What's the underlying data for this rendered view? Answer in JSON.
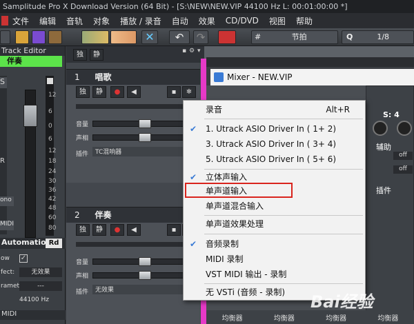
{
  "app": {
    "title": "Samplitude Pro X Download Version (64 Bit) - [S:\\NEW\\NEW.VIP  44100 Hz L: 00:01:00:00 *]"
  },
  "menu": [
    "文件",
    "编辑",
    "音轨",
    "对象",
    "播放 / 录音",
    "自动",
    "效果",
    "CD/DVD",
    "视图",
    "帮助"
  ],
  "toolbar": {
    "beat_label": "节拍",
    "q_label": "Q",
    "q_value": "1/8",
    "mixer_icon": "mixer-x-icon"
  },
  "left_panel": {
    "header": "Track Editor",
    "track_name": "伴奏",
    "scale": [
      "12",
      "6",
      "0",
      "6",
      "12",
      "18",
      "24",
      "30",
      "36",
      "42",
      "48",
      "60",
      "80"
    ],
    "side_labels": [
      "S",
      "R",
      "ono",
      "MIDI"
    ],
    "automation_label": "Automation",
    "automation_mode": "Rd",
    "rows": [
      {
        "label": "ow",
        "value": ""
      },
      {
        "label": "fect:",
        "value": "无效果"
      },
      {
        "label": "rameter",
        "value": "---"
      },
      {
        "label": "",
        "value": "44100 Hz"
      }
    ],
    "bottom_label": "MIDI"
  },
  "tracks": [
    {
      "num": "1",
      "name": "唱歌",
      "solo": "独",
      "mute": "静",
      "vol_label": "音量",
      "pan_label": "声相",
      "insert_label": "插件",
      "insert_value": "TC混响器"
    },
    {
      "num": "2",
      "name": "伴奏",
      "solo": "独",
      "mute": "静",
      "vol_label": "音量",
      "pan_label": "声相",
      "insert_label": "插件",
      "insert_value": "无效果"
    }
  ],
  "track_header_buttons": {
    "solo": "独",
    "mute": "静"
  },
  "mixer": {
    "title": "Mixer - NEW.VIP",
    "s_label": "S: 4",
    "aux_label": "辅助",
    "off1": "off",
    "off2": "off",
    "plugin_label": "插件",
    "eq_labels": [
      "均衡器",
      "均衡器",
      "均衡器",
      "均衡器"
    ]
  },
  "context_menu": {
    "header": {
      "label": "录音",
      "shortcut": "Alt+R"
    },
    "inputs": [
      {
        "label": "1.  Utrack ASIO Driver In ( 1+ 2)",
        "checked": true
      },
      {
        "label": "3.  Utrack ASIO Driver In ( 3+ 4)",
        "checked": false
      },
      {
        "label": "5.  Utrack ASIO Driver In ( 5+ 6)",
        "checked": false
      }
    ],
    "modes": [
      {
        "label": "立体声输入",
        "checked": true
      },
      {
        "label": "单声道输入",
        "checked": false,
        "highlighted": true
      },
      {
        "label": "单声道混合输入",
        "checked": false
      }
    ],
    "fx": {
      "label": "单声道效果处理"
    },
    "types": [
      {
        "label": "音频录制",
        "checked": true
      },
      {
        "label": "MIDI 录制",
        "checked": false
      },
      {
        "label": "VST MIDI 输出 - 录制",
        "checked": false
      }
    ],
    "none": {
      "label": "无 VSTi (音频 - 录制)"
    }
  },
  "watermark": "Bai经验"
}
